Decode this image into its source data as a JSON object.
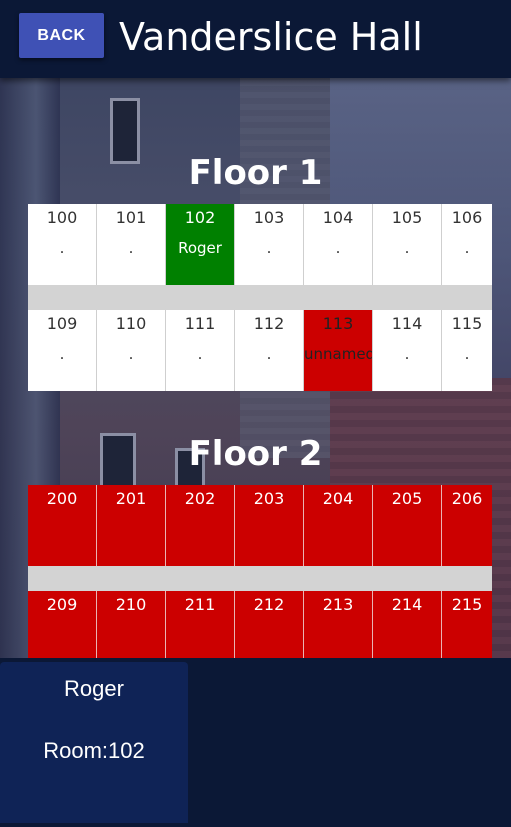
{
  "header": {
    "back_label": "BACK",
    "title": "Vanderslice Hall"
  },
  "floors": [
    {
      "title": "Floor 1",
      "rows": [
        [
          {
            "number": "100",
            "occupant": ".",
            "status": "vacant"
          },
          {
            "number": "101",
            "occupant": ".",
            "status": "vacant"
          },
          {
            "number": "102",
            "occupant": "Roger",
            "status": "selected"
          },
          {
            "number": "103",
            "occupant": ".",
            "status": "vacant"
          },
          {
            "number": "104",
            "occupant": ".",
            "status": "vacant"
          },
          {
            "number": "105",
            "occupant": ".",
            "status": "vacant"
          },
          {
            "number": "106",
            "occupant": ".",
            "status": "vacant"
          }
        ],
        [
          {
            "number": "109",
            "occupant": ".",
            "status": "vacant"
          },
          {
            "number": "110",
            "occupant": ".",
            "status": "vacant"
          },
          {
            "number": "111",
            "occupant": ".",
            "status": "vacant"
          },
          {
            "number": "112",
            "occupant": ".",
            "status": "vacant"
          },
          {
            "number": "113",
            "occupant": "unnamed",
            "status": "taken-dark"
          },
          {
            "number": "114",
            "occupant": ".",
            "status": "vacant"
          },
          {
            "number": "115",
            "occupant": ".",
            "status": "vacant"
          }
        ]
      ]
    },
    {
      "title": "Floor 2",
      "rows": [
        [
          {
            "number": "200",
            "occupant": "",
            "status": "taken"
          },
          {
            "number": "201",
            "occupant": "",
            "status": "taken"
          },
          {
            "number": "202",
            "occupant": "",
            "status": "taken"
          },
          {
            "number": "203",
            "occupant": "",
            "status": "taken"
          },
          {
            "number": "204",
            "occupant": "",
            "status": "taken"
          },
          {
            "number": "205",
            "occupant": "",
            "status": "taken"
          },
          {
            "number": "206",
            "occupant": "",
            "status": "taken"
          }
        ],
        [
          {
            "number": "209",
            "occupant": "",
            "status": "taken"
          },
          {
            "number": "210",
            "occupant": "",
            "status": "taken"
          },
          {
            "number": "211",
            "occupant": "",
            "status": "taken"
          },
          {
            "number": "212",
            "occupant": "",
            "status": "taken"
          },
          {
            "number": "213",
            "occupant": "",
            "status": "taken"
          },
          {
            "number": "214",
            "occupant": "",
            "status": "taken"
          },
          {
            "number": "215",
            "occupant": "",
            "status": "taken"
          }
        ]
      ]
    }
  ],
  "selection": {
    "name": "Roger",
    "room_label": "Room:102"
  },
  "colors": {
    "header_bg": "#0b1836",
    "back_button": "#3f51b5",
    "selected": "#008000",
    "taken": "#cc0000",
    "panel": "#0f2356"
  }
}
